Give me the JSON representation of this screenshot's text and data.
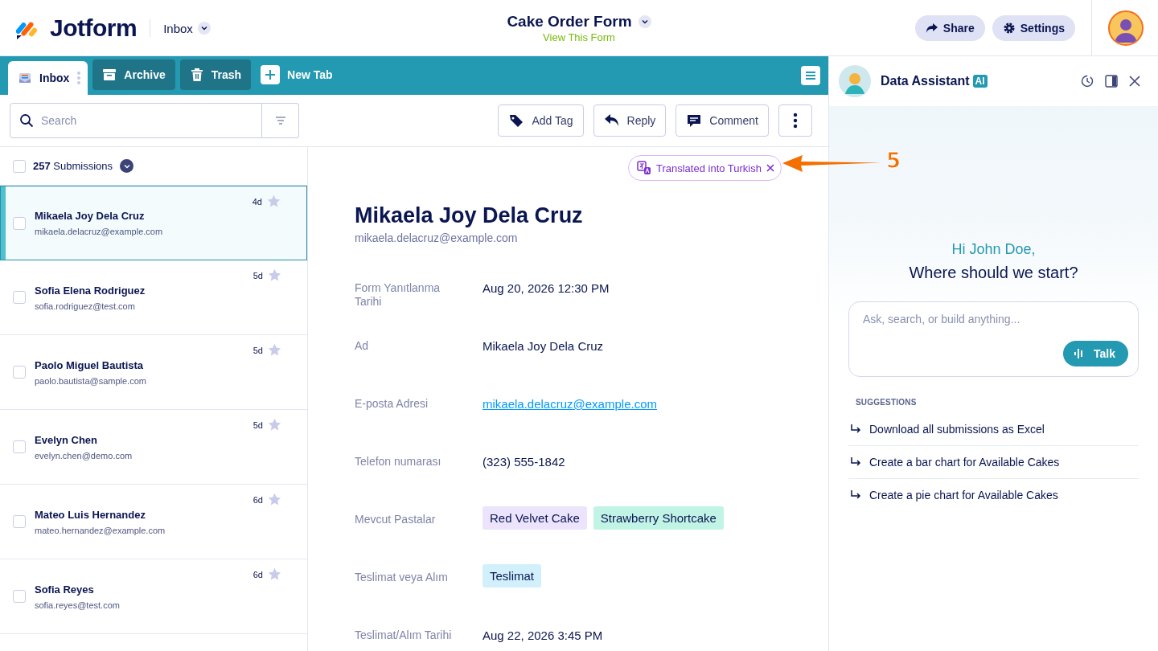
{
  "header": {
    "brand": "Jotform",
    "section": "Inbox",
    "form_title": "Cake Order Form",
    "form_link": "View This Form",
    "buttons": [
      "Share",
      "Settings"
    ]
  },
  "tabs": [
    {
      "label": "Inbox",
      "selected": true
    },
    {
      "label": "Archive",
      "selected": false
    },
    {
      "label": "Trash",
      "selected": false
    },
    {
      "label": "New Tab",
      "selected": false
    }
  ],
  "toolbar": {
    "search_placeholder": "Search",
    "buttons": [
      "Add Tag",
      "Reply",
      "Comment"
    ]
  },
  "list": {
    "count": "**257** Submissions",
    "checked": false,
    "rows": [
      {
        "name": "Mikaela Joy Dela Cruz",
        "email": "mikaela.delacruz@example.com",
        "age": "4d",
        "selected": true,
        "checked": false,
        "starred": false
      },
      {
        "name": "Sofia Elena Rodriguez",
        "email": "sofia.rodriguez@test.com",
        "age": "5d",
        "selected": false,
        "checked": false,
        "starred": false
      },
      {
        "name": "Paolo Miguel Bautista",
        "email": "paolo.bautista@sample.com",
        "age": "5d",
        "selected": false,
        "checked": false,
        "starred": false
      },
      {
        "name": "Evelyn Chen",
        "email": "evelyn.chen@demo.com",
        "age": "5d",
        "selected": false,
        "checked": false,
        "starred": false
      },
      {
        "name": "Mateo Luis Hernandez",
        "email": "mateo.hernandez@example.com",
        "age": "6d",
        "selected": false,
        "checked": false,
        "starred": false
      },
      {
        "name": "Sofia Reyes",
        "email": "sofia.reyes@test.com",
        "age": "6d",
        "selected": false,
        "checked": false,
        "starred": false
      }
    ]
  },
  "detail": {
    "translation_chip": "Translated into Turkish",
    "name": "Mikaela Joy Dela Cruz",
    "email": "mikaela.delacruz@example.com",
    "fields": [
      {
        "label": "Form Yanıtlanma Tarihi",
        "kind": "text",
        "value": "Aug 20, 2026 12:30 PM"
      },
      {
        "label": "Ad",
        "kind": "text",
        "value": "Mikaela Joy Dela Cruz"
      },
      {
        "label": "E-posta Adresi",
        "kind": "link",
        "value": "mikaela.delacruz@example.com"
      },
      {
        "label": "Telefon numarası",
        "kind": "text",
        "value": "(323) 555-1842"
      },
      {
        "label": "Mevcut Pastalar",
        "kind": "tags",
        "tags": [
          {
            "text": "Red Velvet Cake",
            "color": "#ece3fc"
          },
          {
            "text": "Strawberry Shortcake",
            "color": "#c2f4e6"
          }
        ]
      },
      {
        "label": "Teslimat veya Alım",
        "kind": "tags",
        "tags": [
          {
            "text": "Teslimat",
            "color": "#d2f0fb"
          }
        ]
      },
      {
        "label": "Teslimat/Alım Tarihi",
        "kind": "text",
        "value": "Aug 22, 2026 3:45 PM"
      }
    ]
  },
  "assistant": {
    "title": "Data Assistant",
    "badge": "AI",
    "greeting": "Hi John Doe,",
    "question": "Where should we start?",
    "placeholder": "Ask, search, or build anything...",
    "talk_button": "Talk",
    "suggestions_heading": "SUGGESTIONS",
    "suggestions": [
      "Download all submissions as Excel",
      "Create a bar chart for Available Cakes",
      "Create a pie chart for Available Cakes"
    ]
  },
  "annotation": {
    "number": "5"
  }
}
